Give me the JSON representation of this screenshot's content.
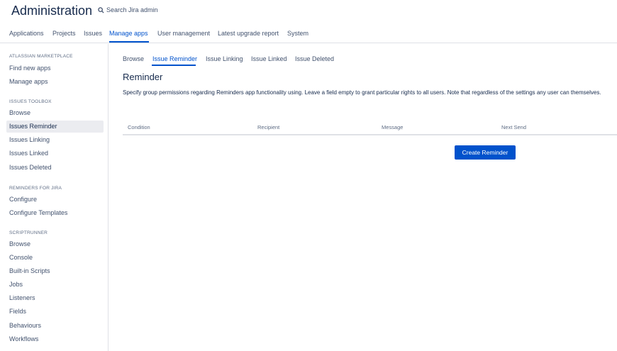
{
  "header": {
    "title": "Administration",
    "search_placeholder": "Search Jira admin"
  },
  "topnav": {
    "items": [
      "Applications",
      "Projects",
      "Issues",
      "Manage apps",
      "User management",
      "Latest upgrade report",
      "System"
    ],
    "active": "Manage apps"
  },
  "sidebar": {
    "sections": [
      {
        "heading": "ATLASSIAN MARKETPLACE",
        "items": [
          "Find new apps",
          "Manage apps"
        ]
      },
      {
        "heading": "ISSUES TOOLBOX",
        "items": [
          "Browse",
          "Issues Reminder",
          "Issues Linking",
          "Issues Linked",
          "Issues Deleted"
        ]
      },
      {
        "heading": "REMINDERS FOR JIRA",
        "items": [
          "Configure",
          "Configure Templates"
        ]
      },
      {
        "heading": "SCRIPTRUNNER",
        "items": [
          "Browse",
          "Console",
          "Built-in Scripts",
          "Jobs",
          "Listeners",
          "Fields",
          "Behaviours",
          "Workflows"
        ]
      }
    ],
    "active_item": "Issues Reminder"
  },
  "subtabs": {
    "items": [
      "Browse",
      "Issue Reminder",
      "Issue Linking",
      "Issue Linked",
      "Issue Deleted"
    ],
    "active": "Issue Reminder"
  },
  "main": {
    "title": "Reminder",
    "description": "Specify group permissions regarding Reminders app functionality using. Leave a field empty to grant particular rights to all users. Note that regardless of the settings any user can themselves.",
    "table_headers": [
      "Condition",
      "Recipient",
      "Message",
      "Next Send"
    ],
    "create_button": "Create Reminder"
  },
  "colors": {
    "accent": "#0052cc",
    "text": "#172b4d",
    "muted": "#42526e",
    "active_bg": "#ebecf0",
    "border": "#dfe1e6"
  }
}
